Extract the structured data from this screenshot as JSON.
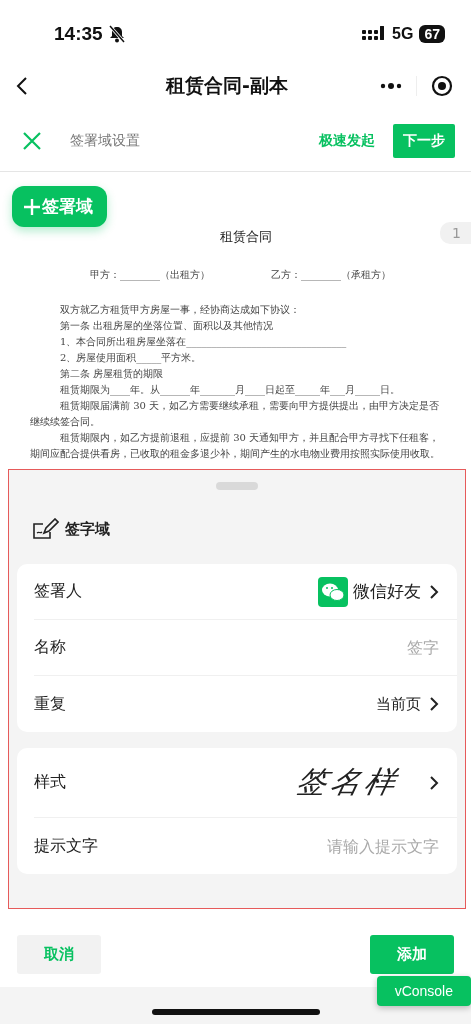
{
  "status_bar": {
    "time": "14:35",
    "network": "5G",
    "battery": "67"
  },
  "nav": {
    "title": "租赁合同-副本"
  },
  "toolbar": {
    "title": "签署域设置",
    "quick_start": "极速发起",
    "next": "下一步"
  },
  "add_field_button": "签署域",
  "page_number": "1",
  "document": {
    "title": "租赁合同",
    "parties": [
      "甲方：________（出租方）",
      "乙方：________（承租方）"
    ],
    "lines": [
      {
        "text": "双方就乙方租赁甲方房屋一事，经协商达成如下协议：",
        "indent": true
      },
      {
        "text": "第一条  出租房屋的坐落位置、面积以及其他情况",
        "indent": true
      },
      {
        "text": "1、本合同所出租房屋坐落在________________________________",
        "indent": true
      },
      {
        "text": "2、房屋使用面积_____平方米。",
        "indent": true
      },
      {
        "text": "第二条  房屋租赁的期限",
        "indent": true
      },
      {
        "text": "租赁期限为____年。从______年_______月____日起至_____年___月_____日。",
        "indent": true
      },
      {
        "text": "租赁期限届满前 30 天，如乙方需要继续承租，需要向甲方提供提出，由甲方决定是否",
        "indent": true
      },
      {
        "text": "继续续签合同。",
        "indent": false
      },
      {
        "text": "租赁期限内，如乙方提前退租，应提前 30 天通知甲方，并且配合甲方寻找下任租客，",
        "indent": true
      },
      {
        "text": "期间应配合提供看房，已收取的租金多退少补，期间产生的水电物业费用按照实际使用收取。",
        "indent": false
      }
    ]
  },
  "sheet": {
    "title": "签字域",
    "groups": [
      {
        "rows": [
          {
            "kind": "contact",
            "label": "签署人",
            "value": "微信好友"
          },
          {
            "kind": "input",
            "label": "名称",
            "placeholder": "签字"
          },
          {
            "kind": "select",
            "label": "重复",
            "value": "当前页"
          }
        ]
      },
      {
        "rows": [
          {
            "kind": "signature",
            "label": "样式",
            "value": "签名样"
          },
          {
            "kind": "input",
            "label": "提示文字",
            "placeholder": "请输入提示文字"
          }
        ]
      }
    ]
  },
  "footer": {
    "cancel": "取消",
    "add": "添加"
  },
  "vconsole": "vConsole"
}
